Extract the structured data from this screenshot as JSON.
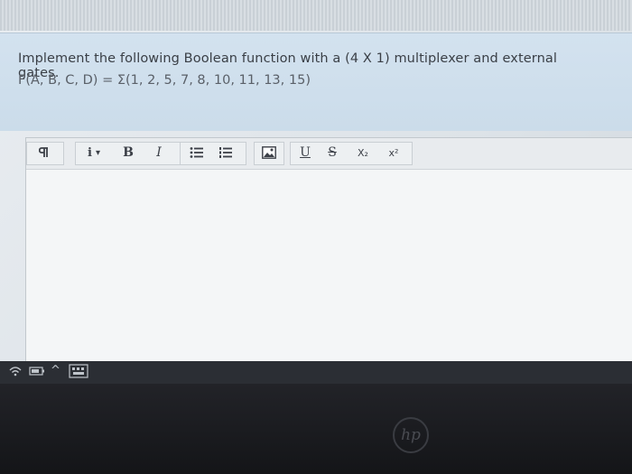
{
  "question": {
    "text": "Implement the following Boolean function with a (4 X 1) multiplexer and external gates.",
    "formula": "F(A, B, C, D) = Σ(1, 2, 5, 7, 8, 10, 11, 13, 15)"
  },
  "toolbar": {
    "paragraph_icon": "paragraph-icon",
    "info_label": "i",
    "info_dropdown": "▾",
    "bold_label": "B",
    "italic_label": "I",
    "bullet_list_icon": "bullet-list-icon",
    "numbered_list_icon": "numbered-list-icon",
    "image_icon": "image-icon",
    "underline_label": "U",
    "strikethrough_label": "S",
    "subscript_label": "X₂",
    "superscript_label": "x²"
  },
  "taskbar": {
    "icons": [
      "wifi-icon",
      "battery-icon",
      "chevron-up-icon",
      "keyboard-icon"
    ]
  },
  "colors": {
    "question_panel": "#cbdcea",
    "editor_background": "#f4f6f7",
    "taskbar": "#2b2e34"
  }
}
